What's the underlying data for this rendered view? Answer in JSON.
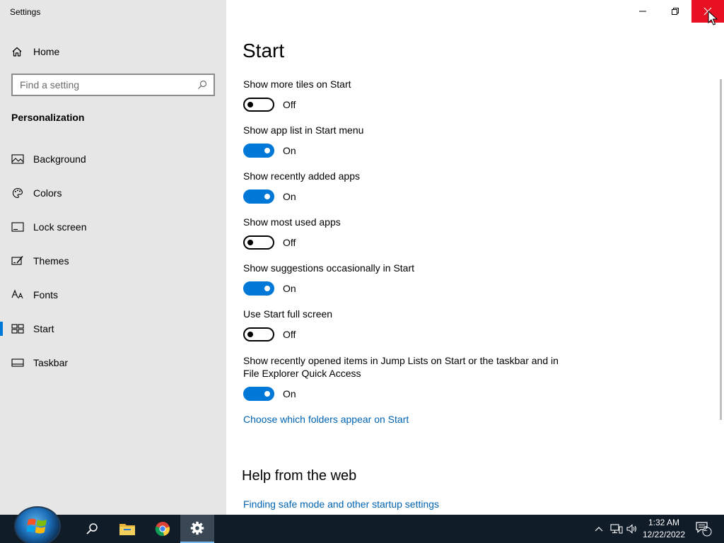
{
  "window": {
    "title": "Settings"
  },
  "nav": {
    "home_label": "Home",
    "search_placeholder": "Find a setting",
    "section_title": "Personalization",
    "items": [
      {
        "label": "Background",
        "icon": "picture-icon",
        "selected": false
      },
      {
        "label": "Colors",
        "icon": "palette-icon",
        "selected": false
      },
      {
        "label": "Lock screen",
        "icon": "lock-screen-icon",
        "selected": false
      },
      {
        "label": "Themes",
        "icon": "themes-icon",
        "selected": false
      },
      {
        "label": "Fonts",
        "icon": "fonts-icon",
        "selected": false
      },
      {
        "label": "Start",
        "icon": "start-icon",
        "selected": true
      },
      {
        "label": "Taskbar",
        "icon": "taskbar-icon",
        "selected": false
      }
    ]
  },
  "main": {
    "title": "Start",
    "settings": [
      {
        "label": "Show more tiles on Start",
        "state": "Off"
      },
      {
        "label": "Show app list in Start menu",
        "state": "On"
      },
      {
        "label": "Show recently added apps",
        "state": "On"
      },
      {
        "label": "Show most used apps",
        "state": "Off"
      },
      {
        "label": "Show suggestions occasionally in Start",
        "state": "On"
      },
      {
        "label": "Use Start full screen",
        "state": "Off"
      },
      {
        "label": "Show recently opened items in Jump Lists on Start or the taskbar and in",
        "label_line2": "File Explorer Quick Access",
        "state": "On"
      }
    ],
    "folders_link": "Choose which folders appear on Start",
    "help_title": "Help from the web",
    "help_link": "Finding safe mode and other startup settings"
  },
  "taskbar": {
    "time": "1:32 AM",
    "date": "12/22/2022",
    "notification_count": "2",
    "pinned": [
      "search-icon",
      "file-explorer-icon",
      "chrome-icon",
      "settings-icon"
    ]
  },
  "colors": {
    "accent": "#0078d7",
    "link": "#0063b1",
    "close": "#e81123",
    "taskbar": "#101c28",
    "nav_bg": "#e6e6e6"
  }
}
